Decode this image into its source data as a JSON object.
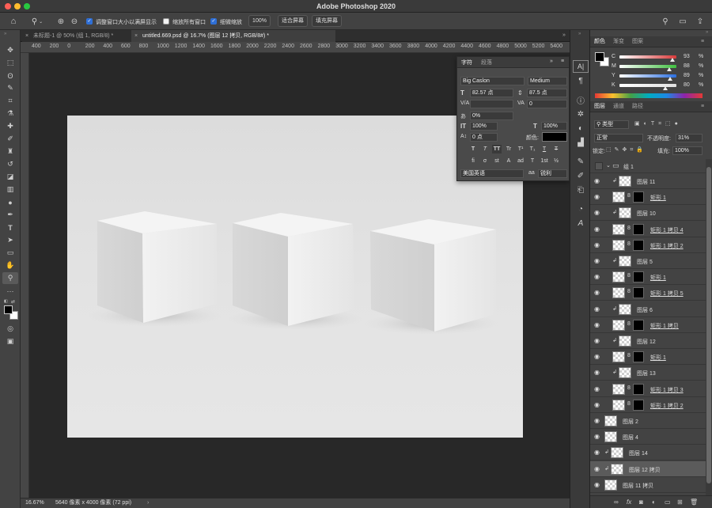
{
  "app": {
    "title": "Adobe Photoshop 2020"
  },
  "options_bar": {
    "resize_windows_label": "调整窗口大小以满屏显示",
    "zoom_all_windows_label": "缩放所有窗口",
    "scrubby_zoom_label": "细微缩放",
    "zoom_100_label": "100%",
    "fit_screen_label": "适合屏幕",
    "fill_screen_label": "填充屏幕"
  },
  "doc_tabs": [
    {
      "label": "未标题-1 @ 50% (组 1, RGB/8) *",
      "active": false
    },
    {
      "label": "untitled.669.psd @ 16.7% (图层 12 拷贝, RGB/8#) *",
      "active": true
    }
  ],
  "ruler_labels": [
    "400",
    "200",
    "0",
    "200",
    "400",
    "600",
    "800",
    "1000",
    "1200",
    "1400",
    "1600",
    "1800",
    "2000",
    "2200",
    "2400",
    "2600",
    "2800",
    "3000",
    "3200",
    "3400",
    "3600",
    "3800",
    "4000",
    "4200",
    "4400",
    "4600",
    "4800",
    "5000",
    "5200",
    "5400"
  ],
  "status": {
    "zoom": "16.67%",
    "doc_info": "5640 像素 x 4000 像素 (72 ppi)"
  },
  "char_panel": {
    "tabs": [
      "字符",
      "段落"
    ],
    "font_family": "Big Caslon",
    "font_style": "Medium",
    "font_size": "82.57 点",
    "leading": "87.5 点",
    "kerning": "",
    "tracking": "0",
    "tsume": "0%",
    "vscale": "100%",
    "hscale": "100%",
    "baseline": "0 点",
    "color_label": "颜色:",
    "language": "美国英语",
    "antialias_label": "aa",
    "antialias": "锐利",
    "type_buttons": [
      "T",
      "T",
      "TT",
      "Tr",
      "T¹",
      "T₁",
      "T",
      "T"
    ],
    "opentype_buttons": [
      "fi",
      "σ",
      "st",
      "A",
      "ad",
      "T",
      "1st",
      "½"
    ]
  },
  "color_panel": {
    "tabs": [
      "颜色",
      "渐变",
      "图案"
    ],
    "channels": [
      {
        "label": "C",
        "value": "93",
        "color": "#d83a3a"
      },
      {
        "label": "M",
        "value": "88",
        "color": "#40c040"
      },
      {
        "label": "Y",
        "value": "89",
        "color": "#2c6fe0"
      },
      {
        "label": "K",
        "value": "80",
        "color": "#e0e0e0"
      }
    ],
    "unit": "%"
  },
  "layers_panel": {
    "tabs": [
      "图层",
      "通道",
      "路径"
    ],
    "filter_kind": "类型",
    "blend_mode": "正常",
    "opacity_label": "不透明度:",
    "opacity": "31%",
    "lock_label": "锁定:",
    "fill_label": "填充:",
    "fill": "100%",
    "group_name": "组 1",
    "layers": [
      {
        "name": "图层 11",
        "indent": 1,
        "clip": true,
        "mask": false,
        "chain": false
      },
      {
        "name": "矩形 1",
        "indent": 1,
        "clip": false,
        "mask": true,
        "chain": true
      },
      {
        "name": "图层 10",
        "indent": 1,
        "clip": true,
        "mask": false,
        "chain": false,
        "nothumb": true
      },
      {
        "name": "矩形 1 拷贝 4",
        "indent": 1,
        "clip": false,
        "mask": true,
        "chain": true
      },
      {
        "name": "矩形 1 拷贝 2",
        "indent": 1,
        "clip": false,
        "mask": true,
        "chain": true
      },
      {
        "name": "图层 5",
        "indent": 1,
        "clip": true,
        "mask": false,
        "chain": false,
        "nothumb": true
      },
      {
        "name": "矩形 1",
        "indent": 1,
        "clip": false,
        "mask": true,
        "chain": true
      },
      {
        "name": "矩形 1 拷贝 5",
        "indent": 1,
        "clip": false,
        "mask": true,
        "chain": true
      },
      {
        "name": "图层 6",
        "indent": 1,
        "clip": true,
        "mask": false,
        "chain": false,
        "nothumb": true
      },
      {
        "name": "矩形 1 拷贝",
        "indent": 1,
        "clip": false,
        "mask": true,
        "chain": true
      },
      {
        "name": "图层 12",
        "indent": 1,
        "clip": true,
        "mask": false,
        "chain": false,
        "nothumb": true
      },
      {
        "name": "矩形 1",
        "indent": 1,
        "clip": false,
        "mask": true,
        "chain": true
      },
      {
        "name": "图层 13",
        "indent": 1,
        "clip": true,
        "mask": false,
        "chain": false,
        "nothumb": true
      },
      {
        "name": "矩形 1 拷贝 3",
        "indent": 1,
        "clip": false,
        "mask": true,
        "chain": true
      },
      {
        "name": "矩形 1 拷贝 2",
        "indent": 1,
        "clip": false,
        "mask": true,
        "chain": true
      },
      {
        "name": "图层 2",
        "indent": 0,
        "clip": false,
        "mask": false,
        "chain": false
      },
      {
        "name": "图层 4",
        "indent": 0,
        "clip": false,
        "mask": false,
        "chain": false
      },
      {
        "name": "图层 14",
        "indent": 0,
        "clip": true,
        "mask": false,
        "chain": false
      },
      {
        "name": "图层 12 拷贝",
        "indent": 0,
        "clip": true,
        "mask": false,
        "chain": false,
        "selected": true
      },
      {
        "name": "图层 11 拷贝",
        "indent": 0,
        "clip": false,
        "mask": false,
        "chain": false
      }
    ]
  }
}
